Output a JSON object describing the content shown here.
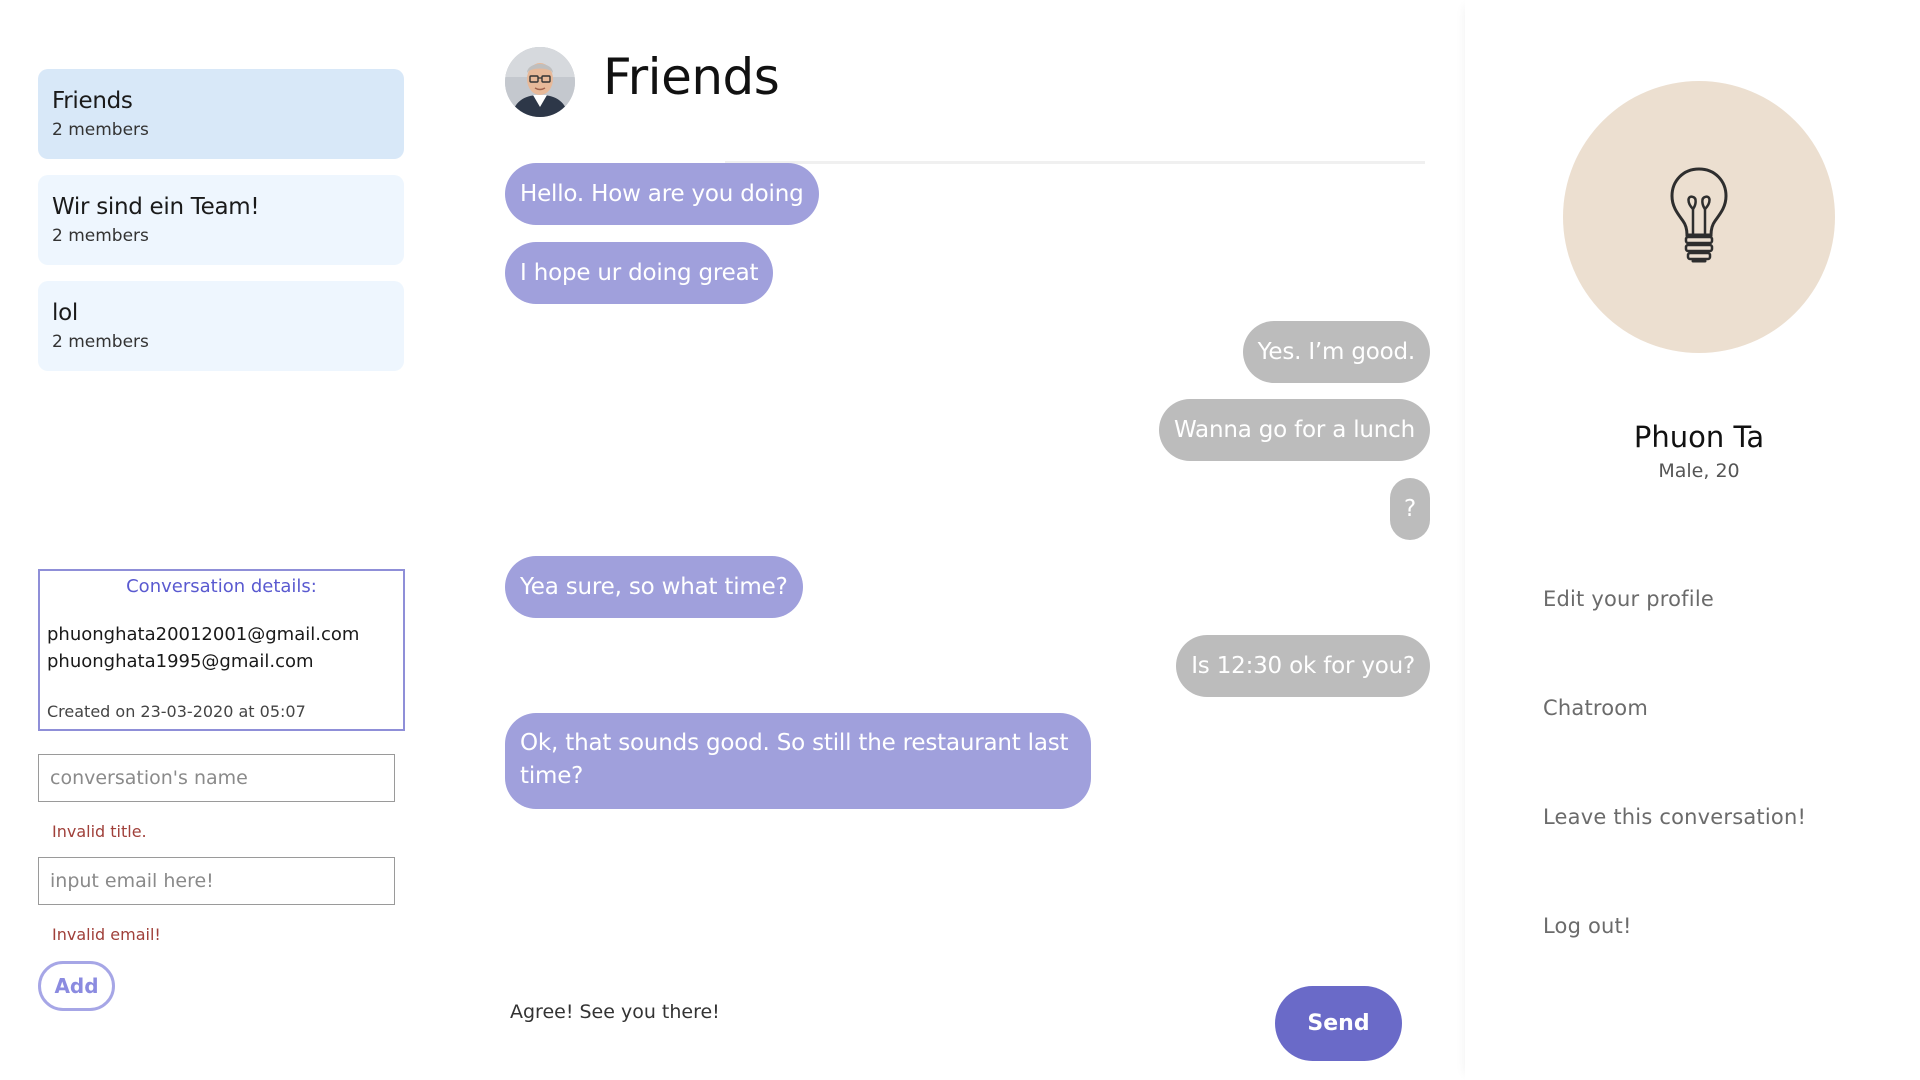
{
  "conversations": [
    {
      "title": "Friends",
      "members": "2 members",
      "active": true
    },
    {
      "title": "Wir sind ein Team!",
      "members": "2 members",
      "active": false
    },
    {
      "title": "lol",
      "members": "2 members",
      "active": false
    }
  ],
  "details": {
    "title": "Conversation details:",
    "emails": [
      "phuonghata20012001@gmail.com",
      "phuonghata1995@gmail.com"
    ],
    "created": "Created on 23-03-2020 at 05:07"
  },
  "forms": {
    "name_placeholder": "conversation's name",
    "name_error": "Invalid title.",
    "email_placeholder": "input email here!",
    "email_error": "Invalid email!",
    "add_label": "Add"
  },
  "chat": {
    "title": "Friends",
    "messages": [
      {
        "text": "Hello. How are you doing",
        "dir": "in"
      },
      {
        "text": "I hope ur doing great",
        "dir": "in"
      },
      {
        "text": "Yes. I’m good.",
        "dir": "out"
      },
      {
        "text": "Wanna go for a lunch",
        "dir": "out"
      },
      {
        "text": "?",
        "dir": "out"
      },
      {
        "text": "Yea sure, so what time?",
        "dir": "in"
      },
      {
        "text": "Is 12:30 ok for you?",
        "dir": "out"
      },
      {
        "text": "Ok, that sounds good. So still the restaurant last time?",
        "dir": "in"
      }
    ],
    "composer_value": "Agree! See you there!",
    "send_label": "Send"
  },
  "profile": {
    "name": "Phuon Ta",
    "info": "Male, 20",
    "icon": "lightbulb-icon",
    "menu": [
      "Edit your profile",
      "Chatroom",
      "Leave this conversation!",
      "Log out!"
    ]
  },
  "colors": {
    "incoming_bubble": "#a0a0dc",
    "outgoing_bubble": "#bcbcbc",
    "send_button": "#6a6ac8",
    "active_card": "#d8e8f8",
    "card": "#eef6fe",
    "error": "#a0403a",
    "profile_circle": "#ecdfd0"
  }
}
